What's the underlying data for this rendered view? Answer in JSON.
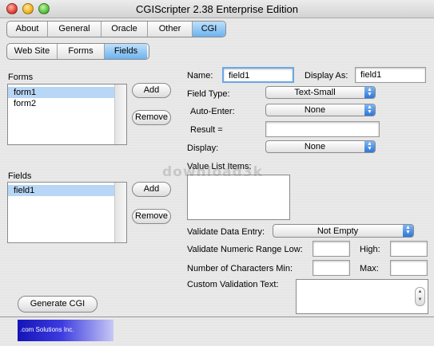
{
  "window": {
    "title": "CGIScripter 2.38 Enterprise Edition"
  },
  "top_tabs": [
    {
      "label": "About",
      "selected": false
    },
    {
      "label": "General",
      "selected": false
    },
    {
      "label": "Oracle",
      "selected": false
    },
    {
      "label": "Other",
      "selected": false
    },
    {
      "label": "CGI",
      "selected": true
    }
  ],
  "sub_tabs": [
    {
      "label": "Web Site",
      "selected": false
    },
    {
      "label": "Forms",
      "selected": false
    },
    {
      "label": "Fields",
      "selected": true
    }
  ],
  "forms_panel": {
    "label": "Forms",
    "items": [
      "form1",
      "form2"
    ],
    "selected_index": 0,
    "add_label": "Add",
    "remove_label": "Remove"
  },
  "fields_panel": {
    "label": "Fields",
    "items": [
      "field1"
    ],
    "selected_index": 0,
    "add_label": "Add",
    "remove_label": "Remove"
  },
  "field_props": {
    "name_label": "Name:",
    "name_value": "field1",
    "display_as_label": "Display As:",
    "display_as_value": "field1",
    "field_type_label": "Field Type:",
    "field_type_value": "Text-Small",
    "auto_enter_label": "Auto-Enter:",
    "auto_enter_value": "None",
    "result_label": "Result =",
    "result_value": "",
    "display_label": "Display:",
    "display_value": "None",
    "value_list_label": "Value List Items:",
    "validate_label": "Validate Data Entry:",
    "validate_value": "Not Empty",
    "range_label": "Validate Numeric Range Low:",
    "high_label": "High:",
    "chars_label": "Number of Characters Min:",
    "max_label": "Max:",
    "custom_label": "Custom Validation Text:"
  },
  "footer": {
    "generate_label": "Generate CGI",
    "logo_text": ".com Solutions Inc."
  },
  "watermark": "download3k",
  "colors": {
    "selected_tab": "#6cb3ee",
    "list_selection": "#b8d6f5",
    "popup_arrow": "#2d77d8"
  }
}
